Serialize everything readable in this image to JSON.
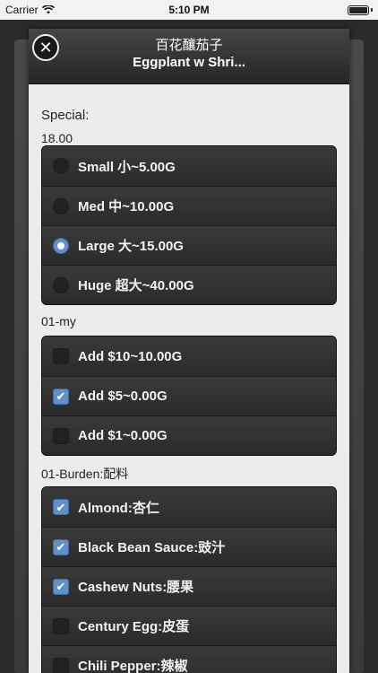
{
  "status": {
    "carrier": "Carrier",
    "time": "5:10 PM"
  },
  "dialog": {
    "title_cn": "百花釀茄子",
    "title_en": "Eggplant w Shri..."
  },
  "special": {
    "label": "Special:",
    "price": "18.00",
    "options": [
      {
        "label": "Small 小~5.00G",
        "selected": false
      },
      {
        "label": "Med 中~10.00G",
        "selected": false
      },
      {
        "label": "Large 大~15.00G",
        "selected": true
      },
      {
        "label": "Huge 超大~40.00G",
        "selected": false
      }
    ]
  },
  "my": {
    "label": "01-my",
    "options": [
      {
        "label": "Add $10~10.00G",
        "checked": false
      },
      {
        "label": "Add $5~0.00G",
        "checked": true
      },
      {
        "label": "Add $1~0.00G",
        "checked": false
      }
    ]
  },
  "burden": {
    "label": "01-Burden:配料",
    "options": [
      {
        "label": "Almond:杏仁",
        "checked": true
      },
      {
        "label": "Black Bean Sauce:豉汁",
        "checked": true
      },
      {
        "label": "Cashew Nuts:腰果",
        "checked": true
      },
      {
        "label": "Century Egg:皮蛋",
        "checked": false
      },
      {
        "label": "Chili Pepper:辣椒",
        "checked": false
      }
    ]
  },
  "colors": {
    "accent": "#5f90c8"
  }
}
